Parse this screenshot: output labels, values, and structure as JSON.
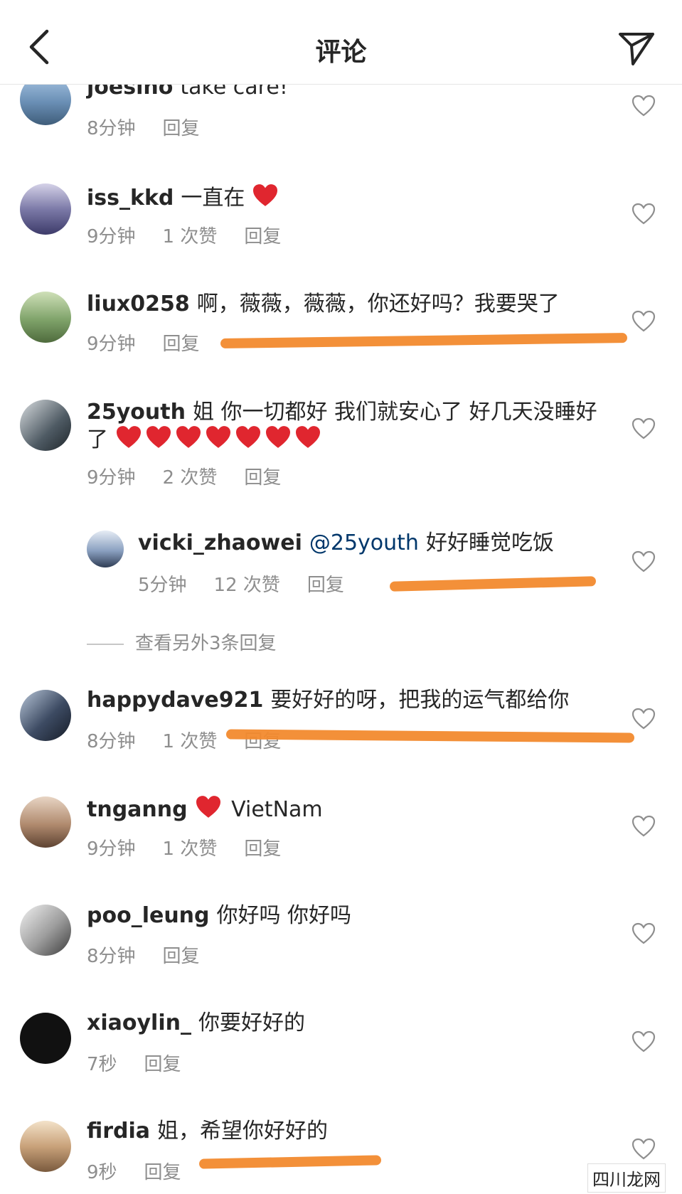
{
  "header": {
    "title": "评论"
  },
  "comments": [
    {
      "user": "joesino",
      "text": "take care!",
      "time": "8分钟",
      "likes": "",
      "reply": "回复",
      "avatar_color": "#6a8fb5"
    },
    {
      "user": "iss_kkd",
      "text": "一直在",
      "time": "9分钟",
      "likes": "1 次赞",
      "reply": "回复",
      "avatar_color": "#7c7aa8"
    },
    {
      "user": "liux0258",
      "text": "啊，薇薇，薇薇，你还好吗？我要哭了",
      "time": "9分钟",
      "likes": "",
      "reply": "回复",
      "avatar_color": "#7fa36a"
    },
    {
      "user": "25youth",
      "text": "姐 你一切都好 我们就安心了 好几天没睡好了",
      "time": "9分钟",
      "likes": "2 次赞",
      "reply": "回复",
      "avatar_color": "#4e5a63"
    },
    {
      "user": "vicki_zhaowei",
      "mention": "@25youth",
      "text": "好好睡觉吃饭",
      "time": "5分钟",
      "likes": "12 次赞",
      "reply": "回复",
      "avatar_color": "#8aa0c0"
    },
    {
      "user": "happydave921",
      "text": "要好好的呀，把我的运气都给你",
      "time": "8分钟",
      "likes": "1 次赞",
      "reply": "回复",
      "avatar_color": "#3d4b63"
    },
    {
      "user": "tnganng",
      "text": "VietNam",
      "time": "9分钟",
      "likes": "1 次赞",
      "reply": "回复",
      "avatar_color": "#b08a6e"
    },
    {
      "user": "poo_leung",
      "text": "你好吗 你好吗",
      "time": "8分钟",
      "likes": "",
      "reply": "回复",
      "avatar_color": "#9c9c9c"
    },
    {
      "user": "xiaoylin_",
      "text": "你要好好的",
      "time": "7秒",
      "likes": "",
      "reply": "回复",
      "avatar_color": "#111111"
    },
    {
      "user": "firdia",
      "text": "姐，希望你好好的",
      "time": "9秒",
      "likes": "",
      "reply": "回复",
      "avatar_color": "#c9a27a"
    }
  ],
  "view_more": "查看另外3条回复",
  "watermark": "四川龙网",
  "colors": {
    "underline": "#f28a2e",
    "emoji_heart": "#e0262f",
    "meta_text": "#8e8e8e",
    "mention": "#00376b"
  }
}
